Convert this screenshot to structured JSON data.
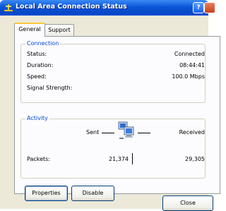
{
  "window": {
    "title": "Local Area Connection Status"
  },
  "tabs": [
    {
      "label": "General",
      "active": true
    },
    {
      "label": "Support",
      "active": false
    }
  ],
  "connection": {
    "group_label": "Connection",
    "rows": [
      {
        "label": "Status:",
        "value": "Connected"
      },
      {
        "label": "Duration:",
        "value": "08:44:41"
      },
      {
        "label": "Speed:",
        "value": "100.0 Mbps"
      },
      {
        "label": "Signal Strength:",
        "value": ""
      }
    ]
  },
  "activity": {
    "group_label": "Activity",
    "sent_label": "Sent",
    "received_label": "Received",
    "packets_label": "Packets:",
    "packets_sent": "21,374",
    "packets_received": "29,305"
  },
  "buttons": {
    "properties": "Properties",
    "disable": "Disable",
    "close": "Close"
  },
  "icons": {
    "title": "network-connection-icon",
    "activity": "computers-network-icon"
  },
  "colors": {
    "titlebar": "#0a56d8",
    "group_label": "#0046d5",
    "dialog_bg": "#ece9d8",
    "tab_highlight": "#ffc83c"
  }
}
